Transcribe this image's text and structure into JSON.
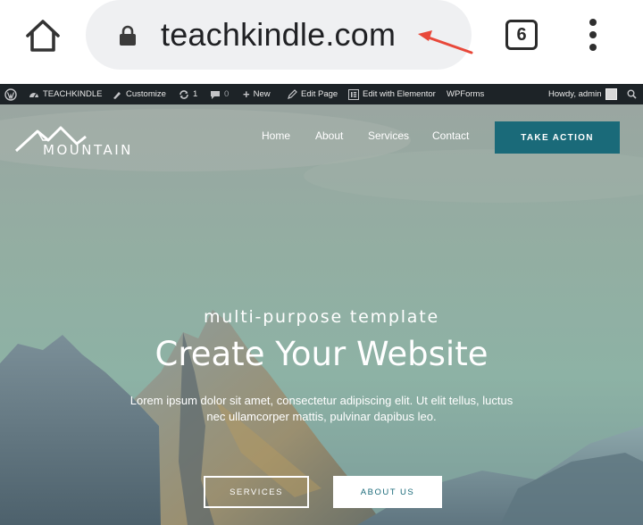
{
  "browser": {
    "url": "teachkindle.com",
    "tab_count": "6",
    "icons": [
      "home-icon",
      "lock-icon",
      "tabs-icon",
      "more-vert-icon"
    ],
    "annotation_color": "#e8483a"
  },
  "adminbar": {
    "site_name": "TEACHKINDLE",
    "customize": "Customize",
    "updates_count": "1",
    "comments_count": "0",
    "new": "New",
    "edit_page": "Edit Page",
    "elementor": "Edit with Elementor",
    "wpforms": "WPForms",
    "greeting": "Howdy, admin",
    "background": "#1d2327"
  },
  "site": {
    "logo_text": "MOUNTAIN",
    "nav": [
      "Home",
      "About",
      "Services",
      "Contact"
    ],
    "cta_label": "TAKE ACTION",
    "accent": "#1a6a79"
  },
  "hero": {
    "subtitle": "multi-purpose template",
    "headline": "Create Your Website",
    "body_line1": "Lorem ipsum dolor sit amet, consectetur adipiscing elit. Ut elit tellus, luctus",
    "body_line2": "nec ullamcorper mattis, pulvinar dapibus leo.",
    "button_services": "SERVICES",
    "button_about": "ABOUT US"
  }
}
